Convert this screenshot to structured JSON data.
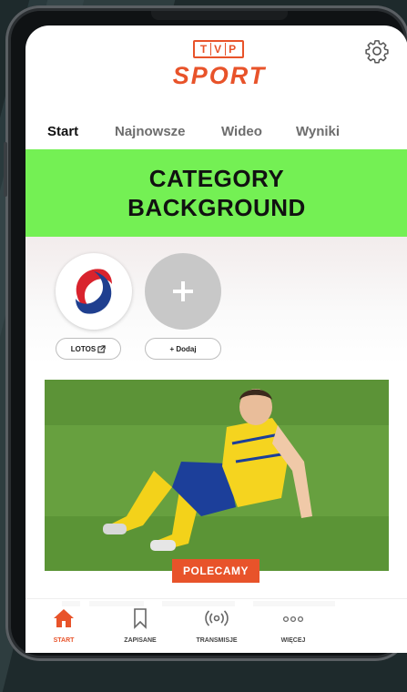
{
  "header": {
    "logo_letters": [
      "T",
      "V",
      "P"
    ],
    "logo_word": "SPORT",
    "settings_icon": "gear-icon"
  },
  "tabs": [
    {
      "label": "Start",
      "active": true
    },
    {
      "label": "Najnowsze",
      "active": false
    },
    {
      "label": "Wideo",
      "active": false
    },
    {
      "label": "Wyniki",
      "active": false
    }
  ],
  "category": {
    "text": "CATEGORY BACKGROUND",
    "color": "#74f054"
  },
  "chips": [
    {
      "label": "LOTOS",
      "icon": "external-link-icon"
    },
    {
      "label": "+ Dodaj",
      "icon": "plus-icon"
    }
  ],
  "article": {
    "badge": "POLECAMY",
    "image": "football-player-sitting-on-pitch"
  },
  "bottom_nav": [
    {
      "label": "START",
      "icon": "home-icon",
      "active": true
    },
    {
      "label": "ZAPISANE",
      "icon": "bookmark-icon",
      "active": false
    },
    {
      "label": "TRANSMISJE",
      "icon": "broadcast-icon",
      "active": false
    },
    {
      "label": "WIĘCEJ",
      "icon": "more-icon",
      "active": false
    }
  ],
  "colors": {
    "accent": "#e8532a",
    "category_bg": "#74f054"
  }
}
